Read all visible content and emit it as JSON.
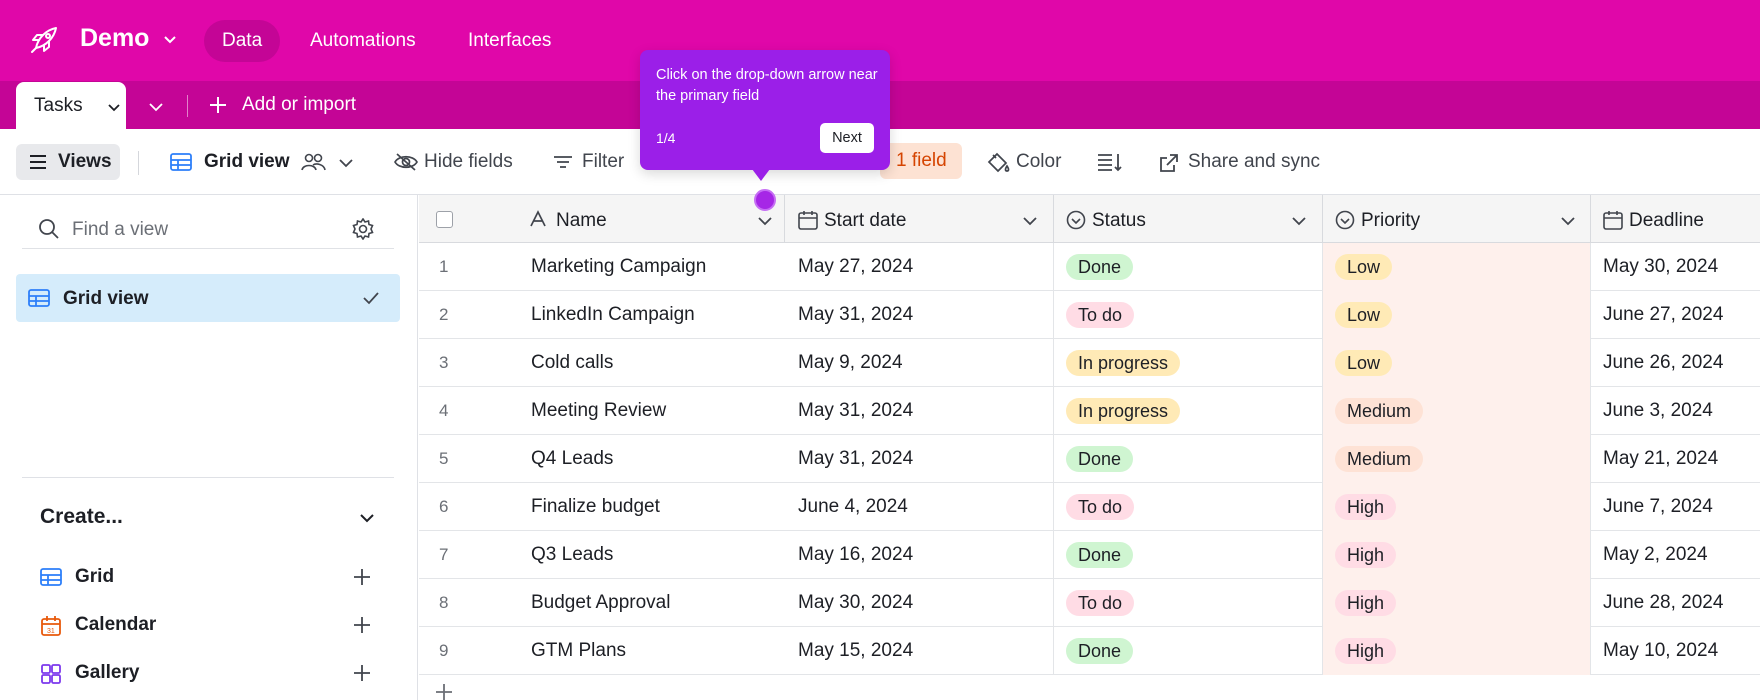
{
  "app": {
    "base_name": "Demo",
    "nav": [
      "Data",
      "Automations",
      "Interfaces"
    ]
  },
  "tabs": {
    "active_table": "Tasks",
    "add_or_import": "Add or import"
  },
  "toolbar": {
    "views": "Views",
    "grid_view": "Grid view",
    "hide_fields": "Hide fields",
    "filter": "Filter",
    "sort_partial": "1 field",
    "color": "Color",
    "share_sync": "Share and sync"
  },
  "sidebar": {
    "search_placeholder": "Find a view",
    "views": [
      {
        "label": "Grid view",
        "selected": true
      }
    ],
    "create_title": "Create...",
    "create_items": [
      {
        "label": "Grid",
        "icon": "grid-icon",
        "color": "#2d7ff9"
      },
      {
        "label": "Calendar",
        "icon": "calendar-icon",
        "color": "#e8590c"
      },
      {
        "label": "Gallery",
        "icon": "gallery-icon",
        "color": "#7c39ed"
      }
    ]
  },
  "grid": {
    "columns": [
      "Name",
      "Start date",
      "Status",
      "Priority",
      "Deadline"
    ],
    "rows": [
      {
        "num": "1",
        "name": "Marketing Campaign",
        "start": "May 27, 2024",
        "status": "Done",
        "priority": "Low",
        "deadline": "May 30, 2024"
      },
      {
        "num": "2",
        "name": "LinkedIn Campaign",
        "start": "May 31, 2024",
        "status": "To do",
        "priority": "Low",
        "deadline": "June 27, 2024"
      },
      {
        "num": "3",
        "name": "Cold calls",
        "start": "May 9, 2024",
        "status": "In progress",
        "priority": "Low",
        "deadline": "June 26, 2024"
      },
      {
        "num": "4",
        "name": "Meeting Review",
        "start": "May 31, 2024",
        "status": "In progress",
        "priority": "Medium",
        "deadline": "June 3, 2024"
      },
      {
        "num": "5",
        "name": "Q4 Leads",
        "start": "May 31, 2024",
        "status": "Done",
        "priority": "Medium",
        "deadline": "May 21, 2024"
      },
      {
        "num": "6",
        "name": "Finalize budget",
        "start": "June 4, 2024",
        "status": "To do",
        "priority": "High",
        "deadline": "June 7, 2024"
      },
      {
        "num": "7",
        "name": "Q3 Leads",
        "start": "May 16, 2024",
        "status": "Done",
        "priority": "High",
        "deadline": "May 2, 2024"
      },
      {
        "num": "8",
        "name": "Budget Approval",
        "start": "May 30, 2024",
        "status": "To do",
        "priority": "High",
        "deadline": "June 28, 2024"
      },
      {
        "num": "9",
        "name": "GTM Plans",
        "start": "May 15, 2024",
        "status": "Done",
        "priority": "High",
        "deadline": "May 10, 2024"
      }
    ],
    "status_colors": {
      "Done": "#cff5d1",
      "To do": "#ffdce5",
      "In progress": "#ffeab6"
    },
    "priority_colors": {
      "Low": "#ffeab6",
      "Medium": "#fee2d5",
      "High": "#ffdce5"
    }
  },
  "tooltip": {
    "text": "Click on the drop-down arrow near the primary field",
    "step": "1/4",
    "next": "Next"
  },
  "colors": {
    "topbar": "#e007a9",
    "tabbar": "#c40596",
    "tooltip": "#9b1fe8"
  }
}
